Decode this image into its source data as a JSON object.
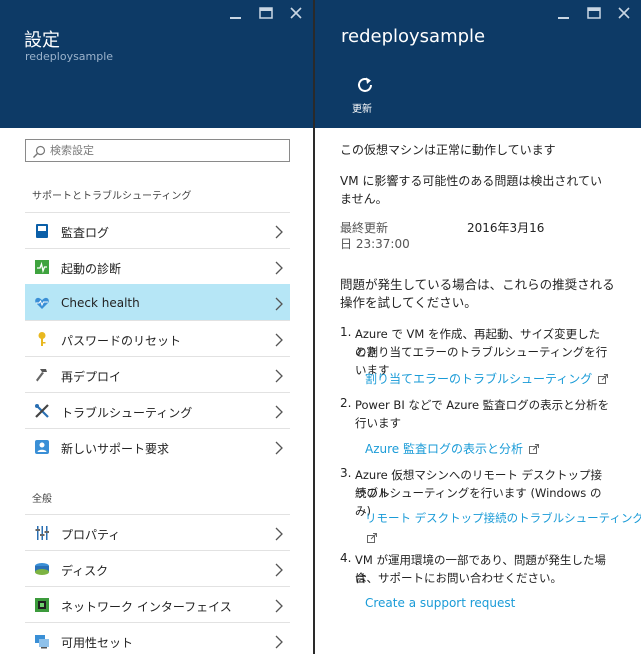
{
  "left_blade": {
    "title": "設定",
    "subtitle": "redeploysample",
    "search": {
      "placeholder": "検索設定",
      "value": ""
    },
    "support_section": "サポートとトラブルシューティング",
    "support_items": [
      {
        "label": "監査ログ",
        "icon": "audit-log-icon"
      },
      {
        "label": "起動の診断",
        "icon": "boot-diagnostics-icon"
      },
      {
        "label": "Check health",
        "icon": "heart-icon",
        "active": true
      },
      {
        "label": "パスワードのリセット",
        "icon": "key-icon"
      },
      {
        "label": "再デプロイ",
        "icon": "hammer-icon"
      },
      {
        "label": "トラブルシューティング",
        "icon": "tools-icon"
      },
      {
        "label": "新しいサポート要求",
        "icon": "support-person-icon"
      }
    ],
    "general_section": "全般",
    "general_items": [
      {
        "label": "プロパティ",
        "icon": "properties-icon"
      },
      {
        "label": "ディスク",
        "icon": "disk-icon"
      },
      {
        "label": "ネットワーク インターフェイス",
        "icon": "network-interface-icon"
      },
      {
        "label": "可用性セット",
        "icon": "availability-set-icon"
      }
    ]
  },
  "right_blade": {
    "title": "redeploysample",
    "toolbar": {
      "refresh_label": "更新"
    },
    "status_text": "この仮想マシンは正常に動作しています",
    "issue_text": "VM に影響する可能性のある問題は検出されていません。",
    "last_updated_label_line1": "最終更新",
    "last_updated_label_line2": "日 23:37:00",
    "last_updated_date": "2016年3月16",
    "recommend_intro_line1": "問題が発生している場合は、これらの推奨される",
    "recommend_intro_line2": "操作を試してください。",
    "steps": [
      {
        "num": "1.",
        "line1": "Azure で VM を作成、再起動、サイズ変更したとき",
        "line2": "の割り当てエラーのトラブルシューティングを行います",
        "link": "割り当てエラーのトラブルシューティング"
      },
      {
        "num": "2.",
        "line1": "Power BI などで Azure 監査ログの表示と分析を",
        "line2": "行います",
        "link": "Azure 監査ログの表示と分析"
      },
      {
        "num": "3.",
        "line1": "Azure 仮想マシンへのリモート デスクトップ接続のト",
        "line2": "ラブルシューティングを行います (Windows のみ)",
        "link": "リモート デスクトップ接続のトラブルシューティング"
      },
      {
        "num": "4.",
        "line1": "VM が運用環境の一部であり、問題が発生した場合",
        "line2": "は、サポートにお問い合わせください。",
        "link": "Create a support request"
      }
    ]
  },
  "colors": {
    "header_bg": "#0d3a66",
    "active_row": "#b6e6f6",
    "link": "#1a9bd7"
  }
}
